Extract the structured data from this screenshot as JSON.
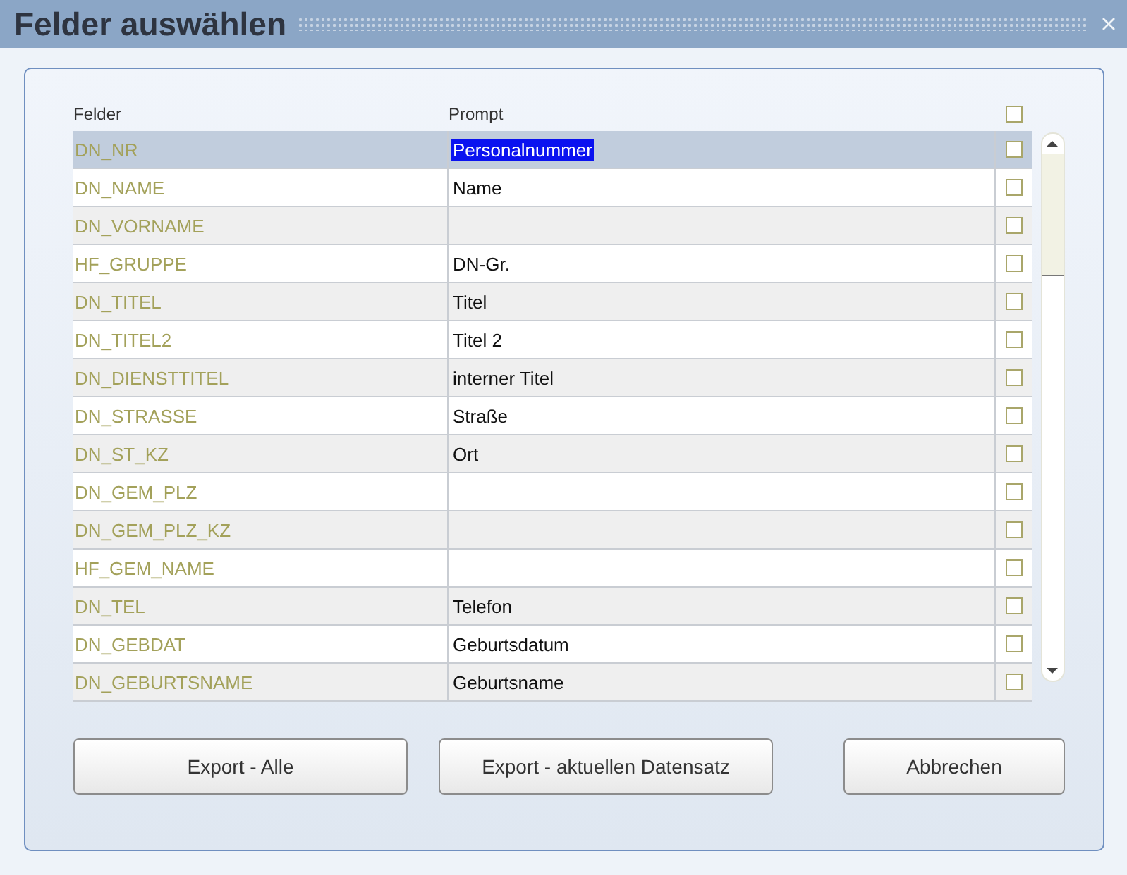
{
  "window": {
    "title": "Felder auswählen"
  },
  "table": {
    "columns": [
      "Felder",
      "Prompt"
    ],
    "header_checked": false,
    "rows": [
      {
        "field": "DN_NR",
        "prompt": "Personalnummer",
        "checked": false,
        "selected": true
      },
      {
        "field": "DN_NAME",
        "prompt": "Name",
        "checked": false,
        "selected": false
      },
      {
        "field": "DN_VORNAME",
        "checked": false,
        "selected": false
      },
      {
        "field": "HF_GRUPPE",
        "prompt": "DN-Gr.",
        "checked": false,
        "selected": false
      },
      {
        "field": "DN_TITEL",
        "prompt": "Titel",
        "checked": false,
        "selected": false
      },
      {
        "field": "DN_TITEL2",
        "prompt": "Titel 2",
        "checked": false,
        "selected": false
      },
      {
        "field": "DN_DIENSTTITEL",
        "prompt": "interner Titel",
        "checked": false,
        "selected": false
      },
      {
        "field": "DN_STRASSE",
        "prompt": "Straße",
        "checked": false,
        "selected": false
      },
      {
        "field": "DN_ST_KZ",
        "prompt": "Ort",
        "checked": false,
        "selected": false
      },
      {
        "field": "DN_GEM_PLZ",
        "checked": false,
        "selected": false
      },
      {
        "field": "DN_GEM_PLZ_KZ",
        "checked": false,
        "selected": false
      },
      {
        "field": "HF_GEM_NAME",
        "checked": false,
        "selected": false
      },
      {
        "field": "DN_TEL",
        "prompt": "Telefon",
        "checked": false,
        "selected": false
      },
      {
        "field": "DN_GEBDAT",
        "prompt": "Geburtsdatum",
        "checked": false,
        "selected": false
      },
      {
        "field": "DN_GEBURTSNAME",
        "prompt": "Geburtsname",
        "checked": false,
        "selected": false
      }
    ]
  },
  "buttons": [
    "Export - Alle",
    "Export - aktuellen Datensatz",
    "Abbrechen"
  ]
}
